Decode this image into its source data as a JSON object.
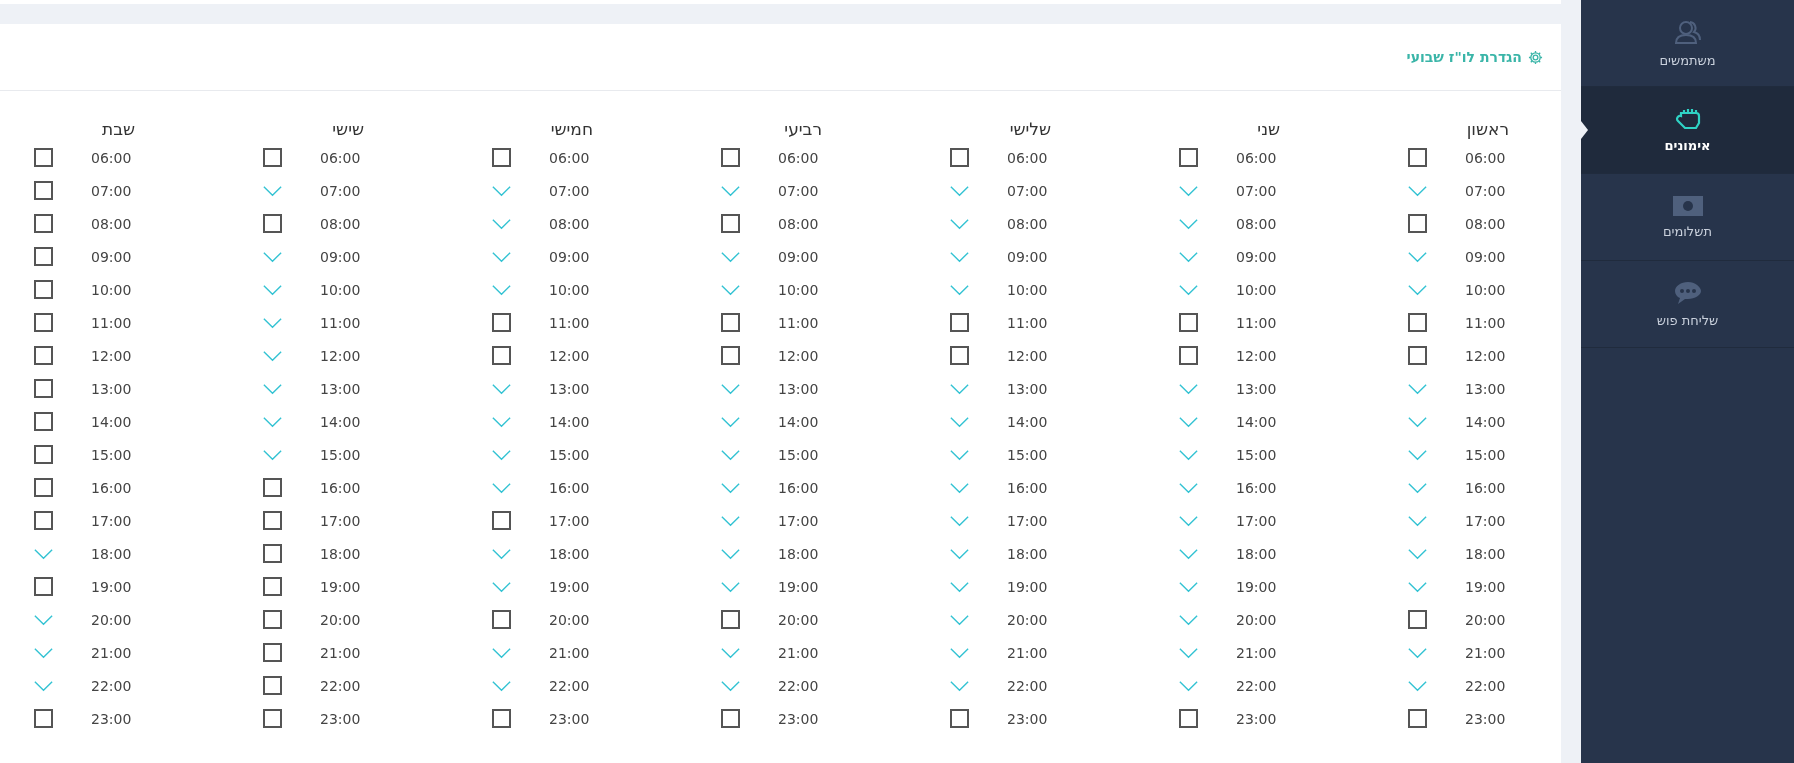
{
  "sidebar": {
    "items": [
      {
        "label": "משתמשים",
        "kind": "users",
        "selected": false
      },
      {
        "label": "אימונים",
        "kind": "fist",
        "selected": true
      },
      {
        "label": "תשלומים",
        "kind": "money",
        "selected": false
      },
      {
        "label": "שליחת פוש",
        "kind": "chat",
        "selected": false
      }
    ]
  },
  "schedule": {
    "title": "הגדרת לו\"ז שבועי",
    "days": [
      {
        "name": "ראשון",
        "slots": [
          {
            "time": "06:00",
            "checked": false
          },
          {
            "time": "07:00",
            "checked": true
          },
          {
            "time": "08:00",
            "checked": false
          },
          {
            "time": "09:00",
            "checked": true
          },
          {
            "time": "10:00",
            "checked": true
          },
          {
            "time": "11:00",
            "checked": false
          },
          {
            "time": "12:00",
            "checked": false
          },
          {
            "time": "13:00",
            "checked": true
          },
          {
            "time": "14:00",
            "checked": true
          },
          {
            "time": "15:00",
            "checked": true
          },
          {
            "time": "16:00",
            "checked": true
          },
          {
            "time": "17:00",
            "checked": true
          },
          {
            "time": "18:00",
            "checked": true
          },
          {
            "time": "19:00",
            "checked": true
          },
          {
            "time": "20:00",
            "checked": false
          },
          {
            "time": "21:00",
            "checked": true
          },
          {
            "time": "22:00",
            "checked": true
          },
          {
            "time": "23:00",
            "checked": false
          }
        ]
      },
      {
        "name": "שני",
        "slots": [
          {
            "time": "06:00",
            "checked": false
          },
          {
            "time": "07:00",
            "checked": true
          },
          {
            "time": "08:00",
            "checked": true
          },
          {
            "time": "09:00",
            "checked": true
          },
          {
            "time": "10:00",
            "checked": true
          },
          {
            "time": "11:00",
            "checked": false
          },
          {
            "time": "12:00",
            "checked": false
          },
          {
            "time": "13:00",
            "checked": true
          },
          {
            "time": "14:00",
            "checked": true
          },
          {
            "time": "15:00",
            "checked": true
          },
          {
            "time": "16:00",
            "checked": true
          },
          {
            "time": "17:00",
            "checked": true
          },
          {
            "time": "18:00",
            "checked": true
          },
          {
            "time": "19:00",
            "checked": true
          },
          {
            "time": "20:00",
            "checked": true
          },
          {
            "time": "21:00",
            "checked": true
          },
          {
            "time": "22:00",
            "checked": true
          },
          {
            "time": "23:00",
            "checked": false
          }
        ]
      },
      {
        "name": "שלישי",
        "slots": [
          {
            "time": "06:00",
            "checked": false
          },
          {
            "time": "07:00",
            "checked": true
          },
          {
            "time": "08:00",
            "checked": true
          },
          {
            "time": "09:00",
            "checked": true
          },
          {
            "time": "10:00",
            "checked": true
          },
          {
            "time": "11:00",
            "checked": false
          },
          {
            "time": "12:00",
            "checked": false
          },
          {
            "time": "13:00",
            "checked": true
          },
          {
            "time": "14:00",
            "checked": true
          },
          {
            "time": "15:00",
            "checked": true
          },
          {
            "time": "16:00",
            "checked": true
          },
          {
            "time": "17:00",
            "checked": true
          },
          {
            "time": "18:00",
            "checked": true
          },
          {
            "time": "19:00",
            "checked": true
          },
          {
            "time": "20:00",
            "checked": true
          },
          {
            "time": "21:00",
            "checked": true
          },
          {
            "time": "22:00",
            "checked": true
          },
          {
            "time": "23:00",
            "checked": false
          }
        ]
      },
      {
        "name": "רביעי",
        "slots": [
          {
            "time": "06:00",
            "checked": false
          },
          {
            "time": "07:00",
            "checked": true
          },
          {
            "time": "08:00",
            "checked": false
          },
          {
            "time": "09:00",
            "checked": true
          },
          {
            "time": "10:00",
            "checked": true
          },
          {
            "time": "11:00",
            "checked": false
          },
          {
            "time": "12:00",
            "checked": false
          },
          {
            "time": "13:00",
            "checked": true
          },
          {
            "time": "14:00",
            "checked": true
          },
          {
            "time": "15:00",
            "checked": true
          },
          {
            "time": "16:00",
            "checked": true
          },
          {
            "time": "17:00",
            "checked": true
          },
          {
            "time": "18:00",
            "checked": true
          },
          {
            "time": "19:00",
            "checked": true
          },
          {
            "time": "20:00",
            "checked": false
          },
          {
            "time": "21:00",
            "checked": true
          },
          {
            "time": "22:00",
            "checked": true
          },
          {
            "time": "23:00",
            "checked": false
          }
        ]
      },
      {
        "name": "חמישי",
        "slots": [
          {
            "time": "06:00",
            "checked": false
          },
          {
            "time": "07:00",
            "checked": true
          },
          {
            "time": "08:00",
            "checked": true
          },
          {
            "time": "09:00",
            "checked": true
          },
          {
            "time": "10:00",
            "checked": true
          },
          {
            "time": "11:00",
            "checked": false
          },
          {
            "time": "12:00",
            "checked": false
          },
          {
            "time": "13:00",
            "checked": true
          },
          {
            "time": "14:00",
            "checked": true
          },
          {
            "time": "15:00",
            "checked": true
          },
          {
            "time": "16:00",
            "checked": true
          },
          {
            "time": "17:00",
            "checked": false
          },
          {
            "time": "18:00",
            "checked": true
          },
          {
            "time": "19:00",
            "checked": true
          },
          {
            "time": "20:00",
            "checked": false
          },
          {
            "time": "21:00",
            "checked": true
          },
          {
            "time": "22:00",
            "checked": true
          },
          {
            "time": "23:00",
            "checked": false
          }
        ]
      },
      {
        "name": "שישי",
        "slots": [
          {
            "time": "06:00",
            "checked": false
          },
          {
            "time": "07:00",
            "checked": true
          },
          {
            "time": "08:00",
            "checked": false
          },
          {
            "time": "09:00",
            "checked": true
          },
          {
            "time": "10:00",
            "checked": true
          },
          {
            "time": "11:00",
            "checked": true
          },
          {
            "time": "12:00",
            "checked": true
          },
          {
            "time": "13:00",
            "checked": true
          },
          {
            "time": "14:00",
            "checked": true
          },
          {
            "time": "15:00",
            "checked": true
          },
          {
            "time": "16:00",
            "checked": false
          },
          {
            "time": "17:00",
            "checked": false
          },
          {
            "time": "18:00",
            "checked": false
          },
          {
            "time": "19:00",
            "checked": false
          },
          {
            "time": "20:00",
            "checked": false
          },
          {
            "time": "21:00",
            "checked": false
          },
          {
            "time": "22:00",
            "checked": false
          },
          {
            "time": "23:00",
            "checked": false
          }
        ]
      },
      {
        "name": "שבת",
        "slots": [
          {
            "time": "06:00",
            "checked": false
          },
          {
            "time": "07:00",
            "checked": false
          },
          {
            "time": "08:00",
            "checked": false
          },
          {
            "time": "09:00",
            "checked": false
          },
          {
            "time": "10:00",
            "checked": false
          },
          {
            "time": "11:00",
            "checked": false
          },
          {
            "time": "12:00",
            "checked": false
          },
          {
            "time": "13:00",
            "checked": false
          },
          {
            "time": "14:00",
            "checked": false
          },
          {
            "time": "15:00",
            "checked": false
          },
          {
            "time": "16:00",
            "checked": false
          },
          {
            "time": "17:00",
            "checked": false
          },
          {
            "time": "18:00",
            "checked": true
          },
          {
            "time": "19:00",
            "checked": false
          },
          {
            "time": "20:00",
            "checked": true
          },
          {
            "time": "21:00",
            "checked": true
          },
          {
            "time": "22:00",
            "checked": true
          },
          {
            "time": "23:00",
            "checked": false
          }
        ]
      }
    ]
  }
}
